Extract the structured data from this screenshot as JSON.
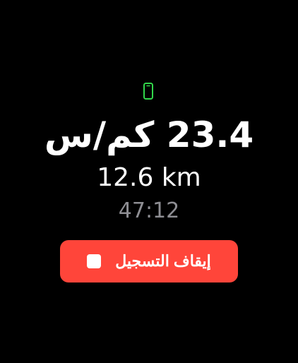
{
  "colors": {
    "background": "#000000",
    "accent_green": "#32d74b",
    "stop_red": "#ff453a",
    "secondary_text": "#8e8e93"
  },
  "status": {
    "device_icon": "phone-icon"
  },
  "metrics": {
    "speed": "23.4 كم/س",
    "distance": "12.6 km",
    "elapsed": "47:12"
  },
  "actions": {
    "stop_label": "إيقاف التسجيل",
    "stop_icon": "stop-square-icon"
  }
}
